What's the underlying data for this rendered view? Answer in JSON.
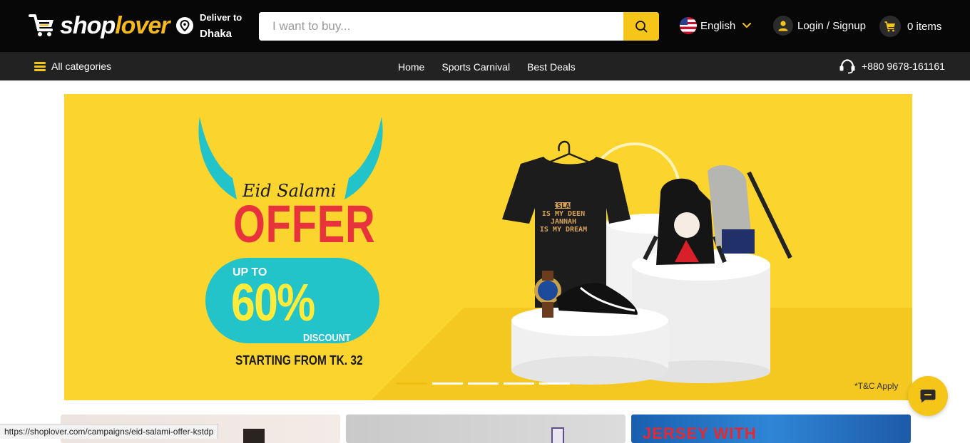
{
  "header": {
    "logo_text_main": "shop",
    "logo_text_accent": "lover",
    "deliver_label": "Deliver to",
    "deliver_city": "Dhaka",
    "search_placeholder": "I want to buy...",
    "language": "English",
    "login_label": "Login / Signup",
    "cart_label": "0 items"
  },
  "nav": {
    "all_categories": "All categories",
    "links": [
      "Home",
      "Sports Carnival",
      "Best Deals"
    ],
    "phone": "+880 9678-161161"
  },
  "banner": {
    "eid_text": "Eid Salami",
    "offer_text": "OFFER",
    "upto_text": "UP TO",
    "percent_text": "60%",
    "discount_text": "DISCOUNT",
    "starting_text": "STARTING FROM TK. 32",
    "shirt_text_1": "ISLAM",
    "shirt_text_2": "IS MY DEEN",
    "shirt_text_3": "JANNAH",
    "shirt_text_4": "IS MY DREAM",
    "tc_text": "*T&C Apply",
    "slide_count": 5,
    "active_slide": 1
  },
  "cards": {
    "card3_text": "JERSEY WITH"
  },
  "status_url": "https://shoplover.com/campaigns/eid-salami-offer-kstdp",
  "colors": {
    "brand_yellow": "#f5c518",
    "topbar": "#070707",
    "navbar": "#222222",
    "offer_red": "#e8333c",
    "teal": "#22c3c9"
  },
  "icons": [
    "cart-logo-icon",
    "location-pin-icon",
    "search-icon",
    "us-flag-icon",
    "chevron-down-icon",
    "user-icon",
    "cart-icon",
    "hamburger-icon",
    "headset-icon",
    "chat-icon"
  ]
}
